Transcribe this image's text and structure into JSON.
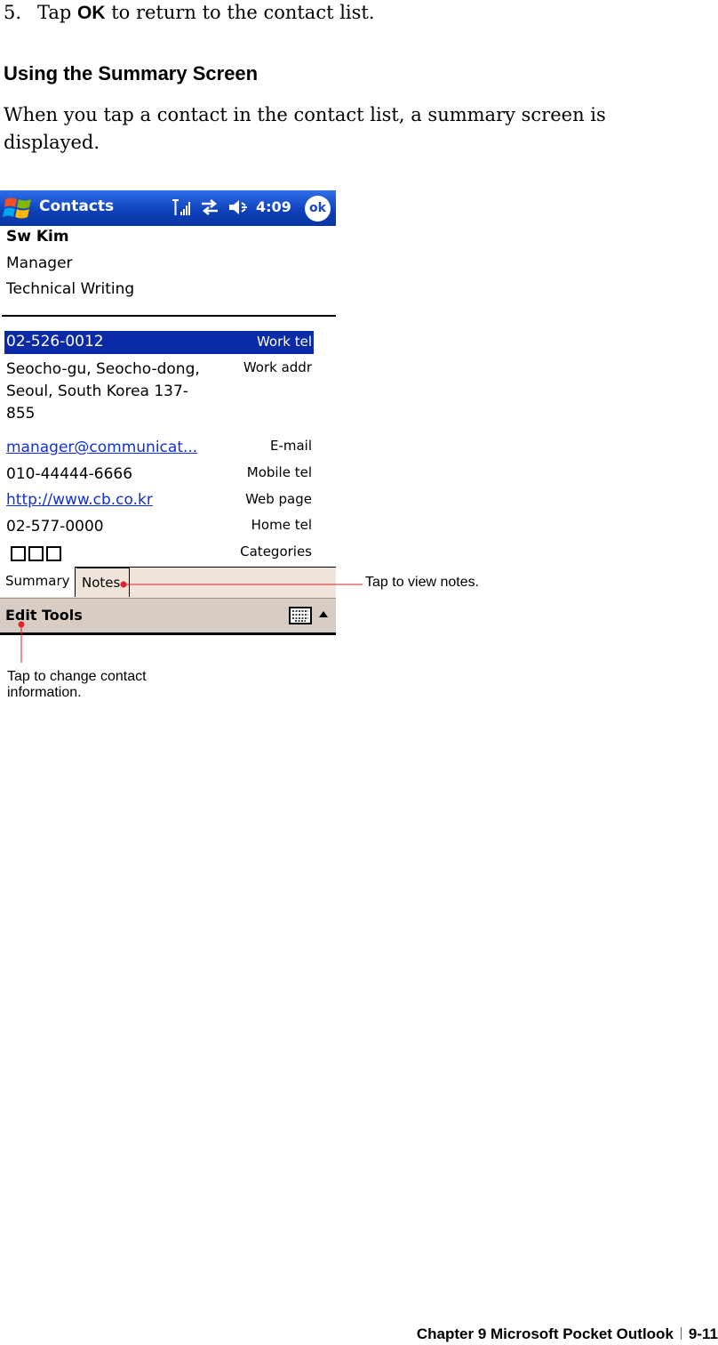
{
  "step": {
    "number": "5.",
    "prefix": "Tap ",
    "bold": "OK",
    "suffix": " to return to the contact list."
  },
  "section_heading": "Using the Summary Screen",
  "paragraph": "When you tap a contact in the contact list, a summary screen is displayed.",
  "screenshot": {
    "title_bar": {
      "app_title": "Contacts",
      "time": "4:09",
      "ok_label": "ok",
      "icons": [
        "windows-start-icon",
        "signal-icon",
        "sync-icon",
        "speaker-icon",
        "ok-icon"
      ]
    },
    "contact": {
      "name": "Sw Kim",
      "job_title": "Manager",
      "department": "Technical Writing"
    },
    "fields": [
      {
        "value": "02-526-0012",
        "label": "Work tel"
      },
      {
        "value_lines": [
          "Seocho-gu, Seocho-dong,",
          "Seoul, South Korea 137-",
          "855"
        ],
        "label": "Work addr"
      },
      {
        "value": "manager@communicat...",
        "label": "E-mail"
      },
      {
        "value": "010-44444-6666",
        "label": "Mobile tel"
      },
      {
        "value": "http://www.cb.co.kr",
        "label": "Web page"
      },
      {
        "value": "02-577-0000",
        "label": "Home tel"
      },
      {
        "value": "",
        "label": "Categories"
      }
    ],
    "tabs": [
      "Summary",
      "Notes"
    ],
    "menu": [
      "Edit",
      "Tools"
    ],
    "accent_colors": {
      "title_bar": "#0d3fb8",
      "selection": "#0a2aa8",
      "callout": "#e0202a"
    }
  },
  "callouts": {
    "notes": "Tap to view notes.",
    "edit": "Tap to change contact information."
  },
  "footer": {
    "chapter": "Chapter 9 Microsoft Pocket Outlook",
    "page": "9-11"
  }
}
